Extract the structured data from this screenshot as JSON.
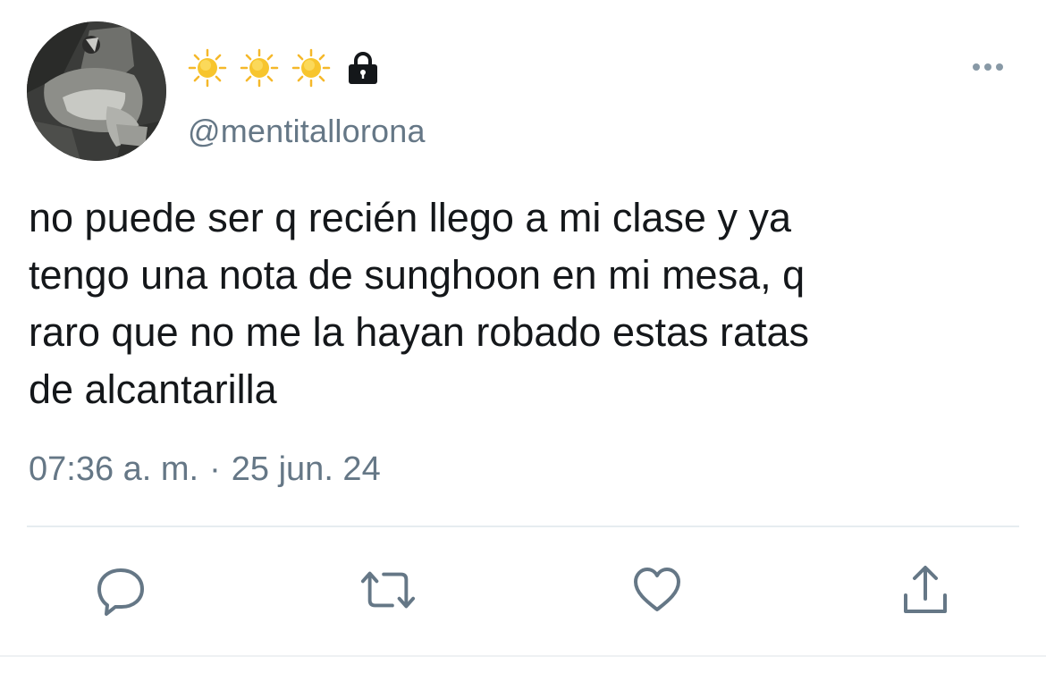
{
  "user": {
    "display_name_icons": [
      "sun-icon",
      "sun-icon",
      "sun-icon"
    ],
    "protected_icon": "lock-icon",
    "handle": "@mentitallorona"
  },
  "more_icon": "more-horizontal-icon",
  "tweet": {
    "text": "no puede ser q recién llego a mi clase y ya\ntengo una nota de sunghoon en mi mesa, q\nraro que no me la hayan robado estas ratas\nde alcantarilla",
    "time": "07:36 a. m.",
    "separator": "·",
    "date": "25 jun. 24"
  },
  "actions": [
    {
      "name": "reply",
      "icon": "reply-icon"
    },
    {
      "name": "retweet",
      "icon": "retweet-icon"
    },
    {
      "name": "like",
      "icon": "heart-icon"
    },
    {
      "name": "share",
      "icon": "share-icon"
    }
  ],
  "colors": {
    "secondary_text": "#657786",
    "icon": "#657786",
    "divider": "#e6ecf0",
    "sun": "#f7c52e"
  }
}
